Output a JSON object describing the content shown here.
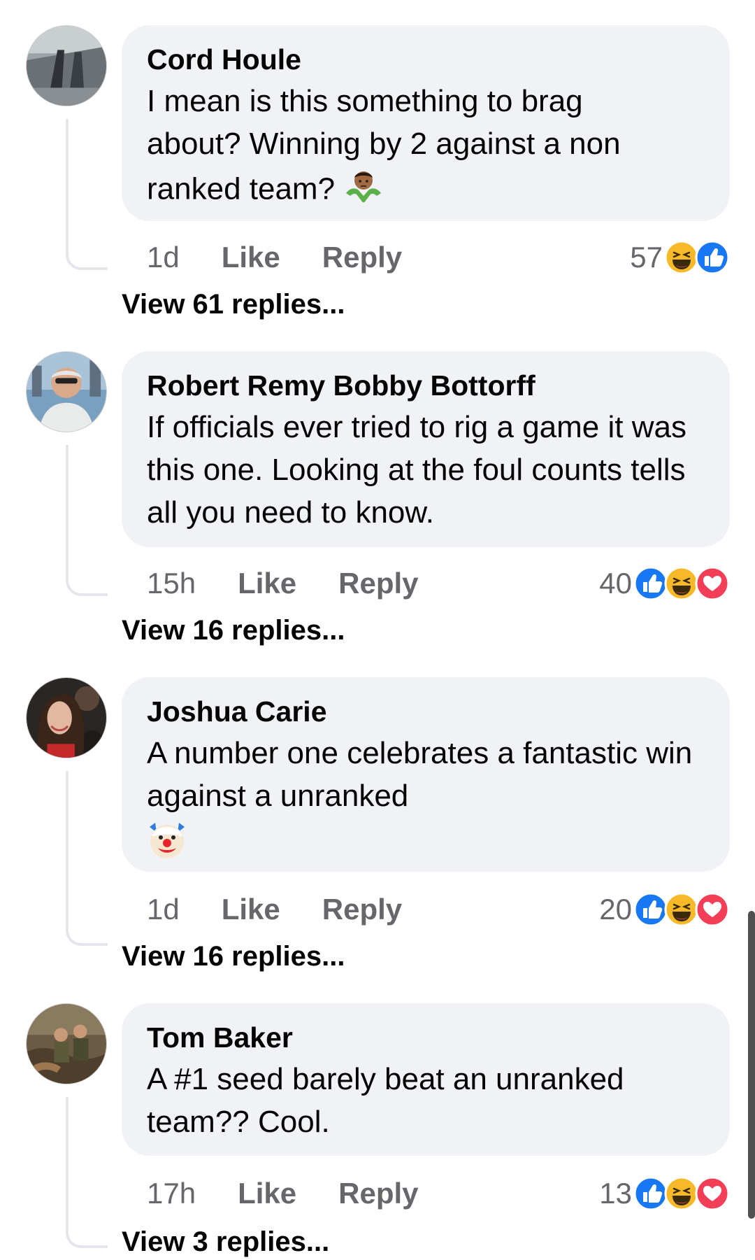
{
  "comments": [
    {
      "author": "Cord Houle",
      "text": "I mean is this something to brag about? Winning by 2 against a non ranked team?",
      "inline_emoji": "person-shrugging",
      "time": "1d",
      "like_label": "Like",
      "reply_label": "Reply",
      "reaction_count": "57",
      "reactions": [
        "haha",
        "like"
      ],
      "view_replies": "View 61 replies..."
    },
    {
      "author": "Robert Remy Bobby Bottorff",
      "text": "If officials ever tried to rig a game it was this one. Looking at the foul counts tells all you need to know.",
      "time": "15h",
      "like_label": "Like",
      "reply_label": "Reply",
      "reaction_count": "40",
      "reactions": [
        "like",
        "haha",
        "love"
      ],
      "view_replies": "View 16 replies..."
    },
    {
      "author": "Joshua Carie",
      "text": "A number one celebrates a fantastic win against a unranked",
      "trailing_emoji": "clown-face",
      "time": "1d",
      "like_label": "Like",
      "reply_label": "Reply",
      "reaction_count": "20",
      "reactions": [
        "like",
        "haha",
        "love"
      ],
      "view_replies": "View 16 replies..."
    },
    {
      "author": "Tom Baker",
      "text": "A #1 seed barely beat an unranked team?? Cool.",
      "time": "17h",
      "like_label": "Like",
      "reply_label": "Reply",
      "reaction_count": "13",
      "reactions": [
        "like",
        "haha",
        "love"
      ],
      "view_replies": "View 3 replies..."
    }
  ],
  "colors": {
    "bubble": "#f0f2f5",
    "meta_text": "#65676b",
    "like_blue": "#1877f2",
    "love_red": "#f33e58",
    "haha_yellow": "#f7b928"
  }
}
